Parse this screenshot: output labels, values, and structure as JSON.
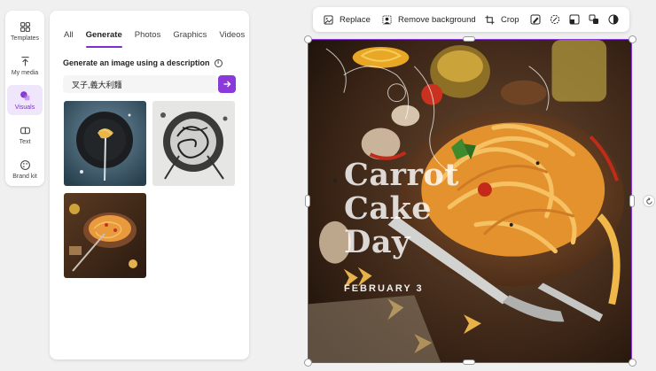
{
  "rail": {
    "items": [
      {
        "label": "Templates",
        "icon": "templates-icon"
      },
      {
        "label": "My media",
        "icon": "upload-icon"
      },
      {
        "label": "Visuals",
        "icon": "visuals-icon",
        "active": true
      },
      {
        "label": "Text",
        "icon": "text-icon"
      },
      {
        "label": "Brand kit",
        "icon": "brand-kit-icon"
      }
    ]
  },
  "panel": {
    "tabs": [
      "All",
      "Generate",
      "Photos",
      "Graphics",
      "Videos"
    ],
    "active_tab": "Generate",
    "heading": "Generate an image using a description",
    "info_glyph": "i",
    "prompt_value": "叉子,義大利麵",
    "results": [
      "spaghetti-plate-dark",
      "spaghetti-sketch-bw",
      "spaghetti-table-warm"
    ]
  },
  "toolbar": {
    "replace": "Replace",
    "remove_background": "Remove background",
    "crop": "Crop"
  },
  "canvas": {
    "title": "Carrot\nCake\nDay",
    "date": "FEBRUARY 3"
  },
  "colors": {
    "accent": "#8a3ad8",
    "active_bg": "#efe6fb"
  }
}
